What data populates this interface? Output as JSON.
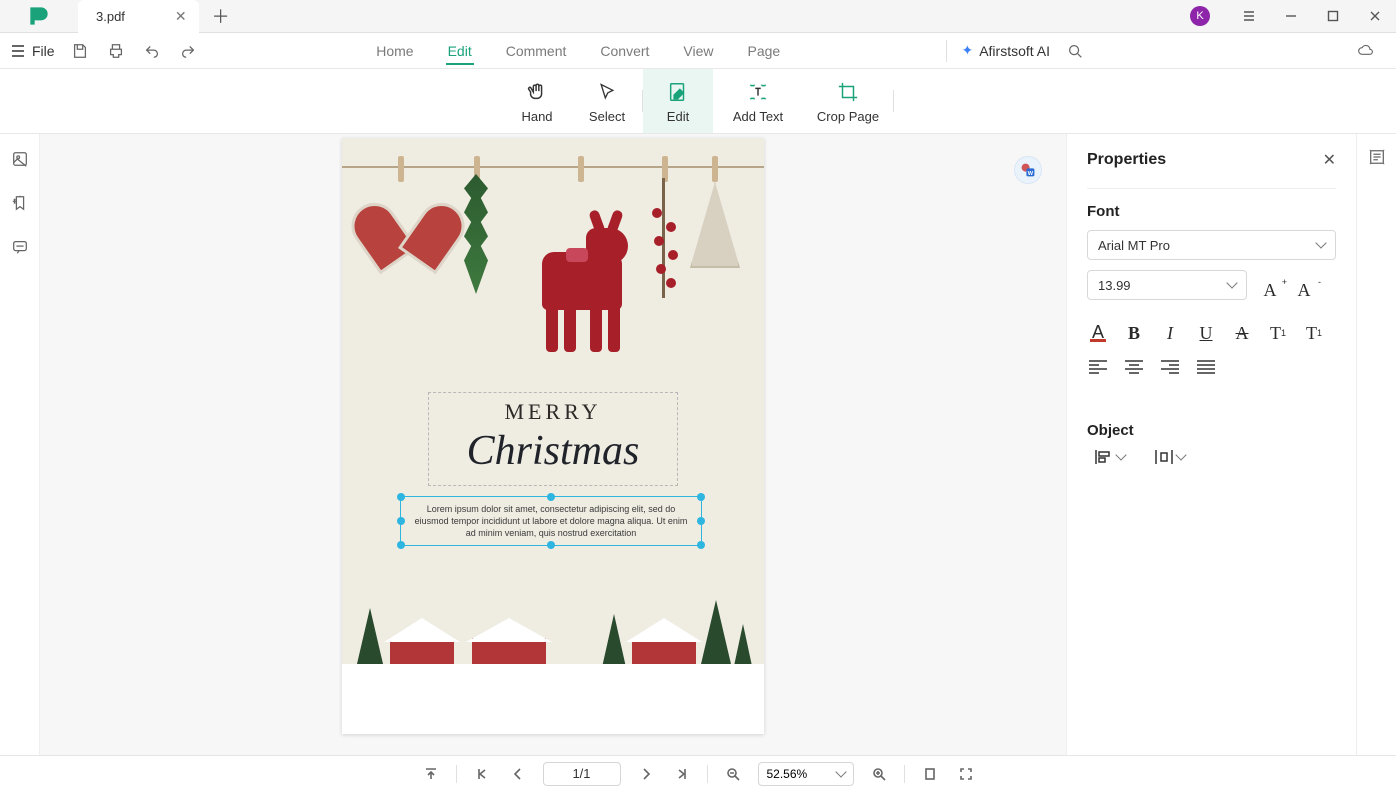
{
  "titlebar": {
    "tab_title": "3.pdf",
    "avatar_letter": "K"
  },
  "menubar": {
    "file_label": "File",
    "items": {
      "home": "Home",
      "edit": "Edit",
      "comment": "Comment",
      "convert": "Convert",
      "view": "View",
      "page": "Page"
    },
    "active": "edit",
    "ai_label": "Afirstsoft AI"
  },
  "toolbar": {
    "hand": "Hand",
    "select": "Select",
    "edit": "Edit",
    "add_text": "Add Text",
    "crop": "Crop Page",
    "active": "edit"
  },
  "document": {
    "heading_1": "MERRY",
    "heading_2": "Christmas",
    "body_text": "Lorem ipsum dolor sit amet, consectetur adipiscing elit, sed do eiusmod tempor incididunt ut labore et dolore magna aliqua. Ut enim ad minim veniam, quis nostrud exercitation"
  },
  "properties": {
    "title": "Properties",
    "font_section": "Font",
    "font_family": "Arial MT Pro",
    "font_size": "13.99",
    "object_section": "Object"
  },
  "bottombar": {
    "page_indicator": "1/1",
    "zoom": "52.56%"
  }
}
